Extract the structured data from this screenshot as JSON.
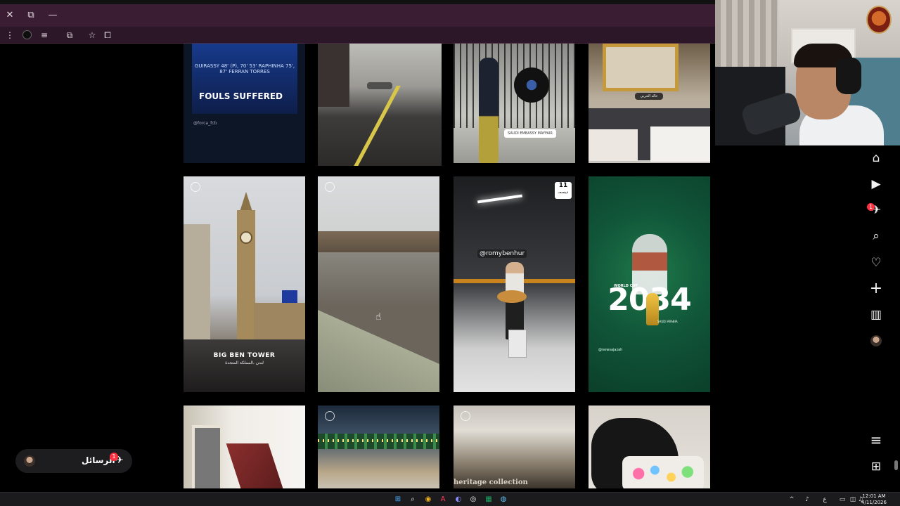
{
  "browser": {
    "window_controls": {
      "close": "✕",
      "restore": "⧉",
      "minimize": "—"
    },
    "toolbar_icons": [
      "menu-dots-icon",
      "tab-search-icon",
      "extensions-icon",
      "bookmark-star-icon",
      "sidebar-icon"
    ]
  },
  "sidebar": {
    "items": [
      {
        "name": "home",
        "glyph": "⌂"
      },
      {
        "name": "reels",
        "glyph": "▶"
      },
      {
        "name": "messages",
        "glyph": "✈",
        "badge": "1"
      },
      {
        "name": "search",
        "glyph": "⌕"
      },
      {
        "name": "notifications",
        "glyph": "♡"
      },
      {
        "name": "create",
        "glyph": "+"
      },
      {
        "name": "dashboard",
        "glyph": "▥"
      },
      {
        "name": "more",
        "glyph": "≡"
      },
      {
        "name": "also-from-meta",
        "glyph": "⊞"
      }
    ]
  },
  "grid": {
    "t1": {
      "scoreline": "GUIRASSY 48' (P), 70'   53' RAPHINHA   75', 87' FERRAN TORRES",
      "fouls": "FOULS SUFFERED",
      "handle": "@forca_fcb"
    },
    "t3": {
      "location_tag": "SAUDI EMBASSY MAYFAIR"
    },
    "t4": {
      "location_tag": "خالد الحربي"
    },
    "t5": {
      "title": "BIG BEN TOWER",
      "subtitle": "لندن ،المملكة المتحدة"
    },
    "t7": {
      "handle": "@romybenhur",
      "date_day": "11",
      "date_month": "ديسمـ"
    },
    "t8": {
      "year": "2034",
      "world_cup": "WORLD CUP",
      "country": "SAUDI ARABIA",
      "handle": "@newsajazah"
    },
    "t11": {
      "text": "heritage collection"
    }
  },
  "messages": {
    "label": "الرسائل",
    "badge": "1"
  },
  "taskbar": {
    "language": "ع",
    "time": "12:01 AM",
    "date": "4/11/2026"
  }
}
